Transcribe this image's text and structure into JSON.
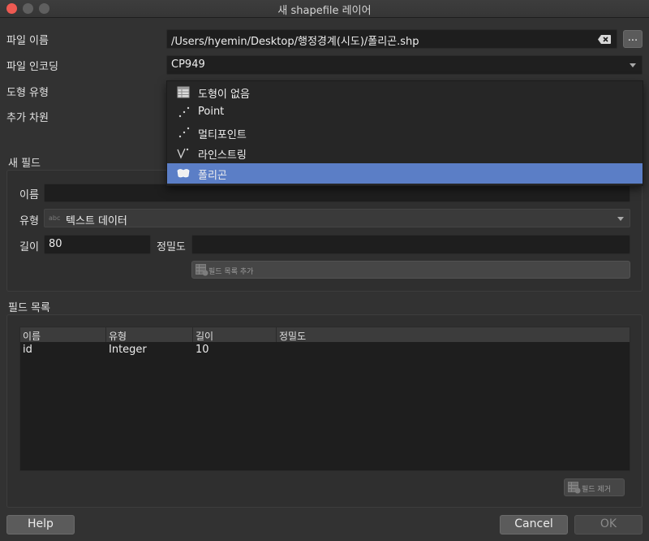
{
  "window": {
    "title": "새 shapefile 레이어"
  },
  "form": {
    "file_name_label": "파일 이름",
    "file_name_value": "/Users/hyemin/Desktop/행정경계(시도)/폴리곤.shp",
    "browse_label": "...",
    "encoding_label": "파일 인코딩",
    "encoding_value": "CP949",
    "geometry_type_label": "도형 유형",
    "extra_dimension_label": "추가 차원"
  },
  "geometry_dropdown": {
    "items": [
      {
        "label": "도형이 없음",
        "icon": "table-icon"
      },
      {
        "label": "Point",
        "icon": "point-icon"
      },
      {
        "label": "멀티포인트",
        "icon": "multipoint-icon"
      },
      {
        "label": "라인스트링",
        "icon": "linestring-icon"
      },
      {
        "label": "폴리곤",
        "icon": "polygon-icon",
        "selected": true
      }
    ]
  },
  "new_field": {
    "section_title": "새 필드",
    "name_label": "이름",
    "name_value": "",
    "type_label": "유형",
    "type_icon_text": "abc",
    "type_value": "텍스트 데이터",
    "length_label": "길이",
    "length_value": "80",
    "precision_label": "정밀도",
    "precision_value": "",
    "add_button_label": "필드 목록 추가"
  },
  "field_list": {
    "section_title": "필드 목록",
    "columns": [
      "이름",
      "유형",
      "길이",
      "정밀도"
    ],
    "rows": [
      [
        "id",
        "Integer",
        "10",
        ""
      ]
    ],
    "remove_button_label": "필드 제거"
  },
  "footer": {
    "help_label": "Help",
    "cancel_label": "Cancel",
    "ok_label": "OK"
  }
}
